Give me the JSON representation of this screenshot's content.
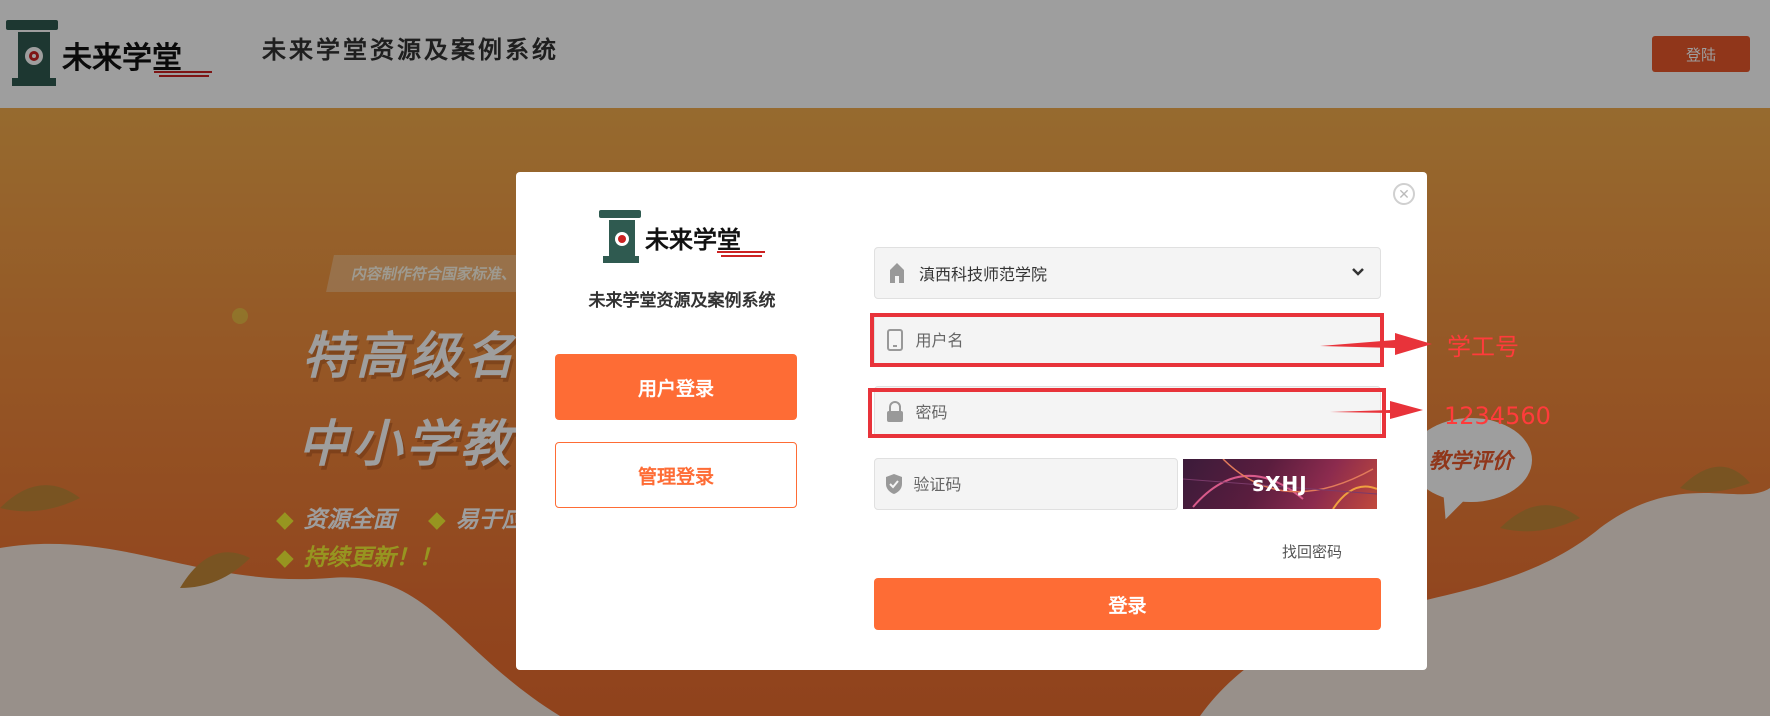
{
  "header": {
    "logo_text": "未来学堂",
    "site_title": "未来学堂资源及案例系统",
    "login_button": "登陆"
  },
  "hero": {
    "tag": "内容制作符合国家标准、更",
    "line1": "特高级名",
    "line2": "中小学教",
    "bullets": [
      "资源全面",
      "易于应",
      "持续更新！！"
    ],
    "bubble": "教学评价"
  },
  "modal": {
    "logo_text": "未来学堂",
    "title": "未来学堂资源及案例系统",
    "tabs": {
      "user": "用户登录",
      "admin": "管理登录"
    },
    "school_select": {
      "value": "滇西科技师范学院",
      "icon": "school-icon"
    },
    "username": {
      "placeholder": "用户名",
      "icon": "phone-icon"
    },
    "password": {
      "placeholder": "密码",
      "icon": "lock-icon"
    },
    "captcha": {
      "placeholder": "验证码",
      "image_text": "sXHJ",
      "icon": "shield-icon"
    },
    "forgot": "找回密码",
    "submit": "登录",
    "close_icon": "close-icon"
  },
  "annotations": {
    "username_hint": "学工号",
    "password_hint": "1234560"
  },
  "colors": {
    "accent": "#fe6c35",
    "header_button": "#e8572a",
    "annotation": "#e8333a"
  }
}
